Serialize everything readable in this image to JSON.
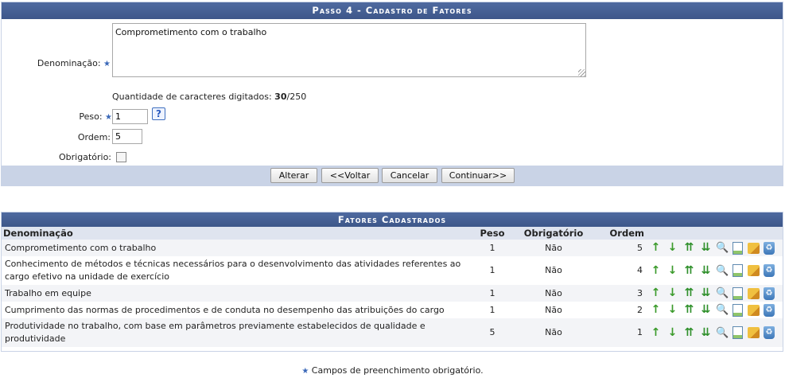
{
  "form": {
    "title": "Passo 4 - Cadastro de Fatores",
    "denominacao_label": "Denominação:",
    "denominacao_value": "Comprometimento com o trabalho",
    "char_count_prefix": "Quantidade de caracteres digitados: ",
    "char_count_value": "30",
    "char_count_max": "/250",
    "peso_label": "Peso:",
    "peso_value": "1",
    "help_label": "?",
    "ordem_label": "Ordem:",
    "ordem_value": "5",
    "obrigatorio_label": "Obrigatório:",
    "obrigatorio_checked": false,
    "required_mark": "★",
    "buttons": {
      "alterar": "Alterar",
      "voltar": "<<Voltar",
      "cancelar": "Cancelar",
      "continuar": "Continuar>>"
    }
  },
  "list": {
    "title": "Fatores Cadastrados",
    "columns": [
      "Denominação",
      "Peso",
      "Obrigatório",
      "Ordem"
    ],
    "rows": [
      {
        "denominacao": "Comprometimento com o trabalho",
        "peso": "1",
        "obrigatorio": "Não",
        "ordem": "5"
      },
      {
        "denominacao": "Conhecimento de métodos e técnicas necessários para o desenvolvimento das atividades referentes ao cargo efetivo na unidade de exercício",
        "peso": "1",
        "obrigatorio": "Não",
        "ordem": "4"
      },
      {
        "denominacao": "Trabalho em equipe",
        "peso": "1",
        "obrigatorio": "Não",
        "ordem": "3"
      },
      {
        "denominacao": "Cumprimento das normas de procedimentos e de conduta no desempenho das atribuições do cargo",
        "peso": "1",
        "obrigatorio": "Não",
        "ordem": "2"
      },
      {
        "denominacao": "Produtividade no trabalho, com base em parâmetros previamente estabelecidos de qualidade e produtividade",
        "peso": "5",
        "obrigatorio": "Não",
        "ordem": "1"
      }
    ],
    "row_actions": [
      "move-up-icon",
      "move-down-icon",
      "move-to-top-icon",
      "move-to-bottom-icon",
      "view-icon",
      "details-icon",
      "edit-icon",
      "delete-icon"
    ]
  },
  "footer": {
    "required_mark": "★",
    "text": " Campos de preenchimento obrigatório."
  },
  "colors": {
    "header_bar": "#3d5689",
    "actions_bar": "#c9d3e6",
    "table_header": "#dfe4ef",
    "row_alt": "#f3f4f7",
    "required_star": "#3a68b8",
    "move_icons": "#3a9a2a"
  }
}
